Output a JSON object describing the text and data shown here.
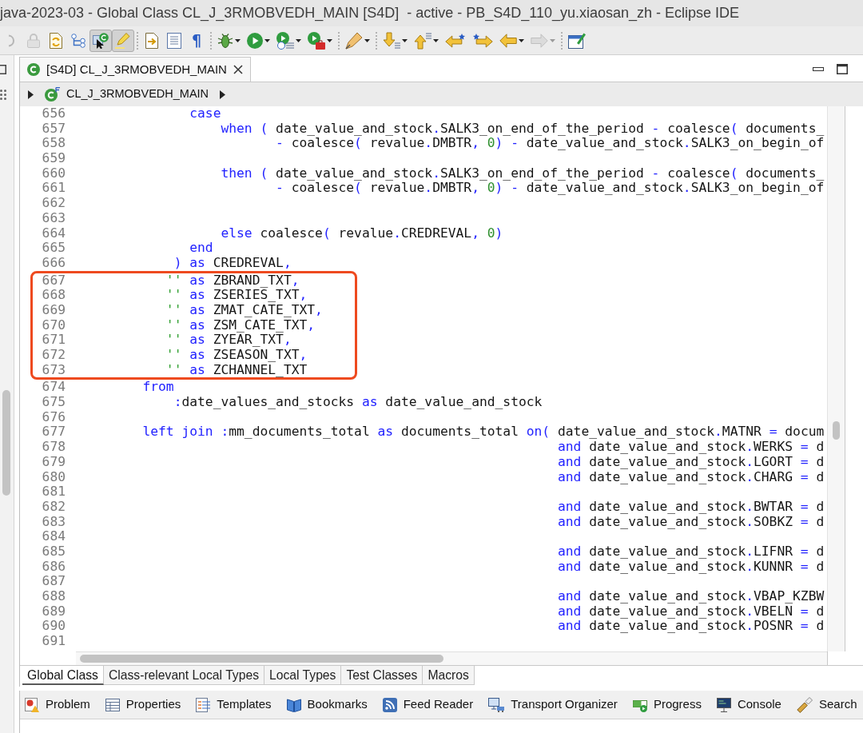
{
  "window": {
    "title": "java-2023-03 - Global Class CL_J_3RMOBVEDH_MAIN [S4D]  - active - PB_S4D_110_yu.xiaosan_zh - Eclipse IDE"
  },
  "toolbar": [
    {
      "kind": "button",
      "on": false,
      "disabled": true,
      "dropdown": false
    },
    {
      "kind": "button",
      "on": false,
      "disabled": true,
      "dropdown": false
    },
    {
      "kind": "button",
      "on": false,
      "disabled": false,
      "dropdown": false
    },
    {
      "kind": "button",
      "on": false,
      "disabled": false,
      "dropdown": false
    },
    {
      "kind": "button",
      "on": true,
      "disabled": false,
      "dropdown": false
    },
    {
      "kind": "button",
      "on": true,
      "disabled": false,
      "dropdown": false
    },
    {
      "kind": "separator"
    },
    {
      "kind": "button",
      "on": false,
      "disabled": false,
      "dropdown": false
    },
    {
      "kind": "button",
      "on": false,
      "disabled": false,
      "dropdown": false
    },
    {
      "kind": "glyph",
      "label": "¶",
      "on": false,
      "disabled": false,
      "dropdown": false
    },
    {
      "kind": "separator"
    },
    {
      "kind": "button",
      "on": false,
      "disabled": false,
      "dropdown": true
    },
    {
      "kind": "button",
      "on": false,
      "disabled": false,
      "dropdown": true
    },
    {
      "kind": "button",
      "on": false,
      "disabled": false,
      "dropdown": true
    },
    {
      "kind": "button",
      "on": false,
      "disabled": false,
      "dropdown": true
    },
    {
      "kind": "separator"
    },
    {
      "kind": "button",
      "on": false,
      "disabled": false,
      "dropdown": true
    },
    {
      "kind": "separator"
    },
    {
      "kind": "button",
      "on": false,
      "disabled": false,
      "dropdown": true
    },
    {
      "kind": "button",
      "on": false,
      "disabled": false,
      "dropdown": true
    },
    {
      "kind": "button",
      "on": false,
      "disabled": false,
      "dropdown": false
    },
    {
      "kind": "button",
      "on": false,
      "disabled": false,
      "dropdown": false
    },
    {
      "kind": "button",
      "on": false,
      "disabled": false,
      "dropdown": true
    },
    {
      "kind": "button",
      "on": false,
      "disabled": true,
      "dropdown": true
    },
    {
      "kind": "separator"
    },
    {
      "kind": "button",
      "on": false,
      "disabled": false,
      "dropdown": false
    }
  ],
  "editor": {
    "tabs": [
      {
        "label": "[S4D] CL_J_3RMOBVEDH_MAIN",
        "selected": true
      }
    ],
    "breadcrumb": {
      "label": "CL_J_3RMOBVEDH_MAIN"
    },
    "blocks": [
      {
        "highlighted": false,
        "lines": [
          {
            "number": "656",
            "code": [
              {
                "kind": "keyword",
                "text": "              case"
              }
            ]
          },
          {
            "number": "657",
            "code": [
              {
                "kind": "keyword",
                "text": "                  when ( "
              },
              {
                "kind": "plain",
                "text": "date_value_and_stock"
              },
              {
                "kind": "keyword",
                "text": "."
              },
              {
                "kind": "plain",
                "text": "SALK3_on_end_of_the_period "
              },
              {
                "kind": "keyword",
                "text": "- "
              },
              {
                "kind": "plain",
                "text": "coalesce"
              },
              {
                "kind": "keyword",
                "text": "( "
              },
              {
                "kind": "plain",
                "text": "documents_"
              }
            ]
          },
          {
            "number": "658",
            "code": [
              {
                "kind": "keyword",
                "text": "                         - "
              },
              {
                "kind": "plain",
                "text": "coalesce"
              },
              {
                "kind": "keyword",
                "text": "( "
              },
              {
                "kind": "plain",
                "text": "revalue"
              },
              {
                "kind": "keyword",
                "text": "."
              },
              {
                "kind": "plain",
                "text": "DMBTR"
              },
              {
                "kind": "keyword",
                "text": ", "
              },
              {
                "kind": "number",
                "text": "0"
              },
              {
                "kind": "keyword",
                "text": ") - "
              },
              {
                "kind": "plain",
                "text": "date_value_and_stock"
              },
              {
                "kind": "keyword",
                "text": "."
              },
              {
                "kind": "plain",
                "text": "SALK3_on_begin_of"
              }
            ]
          },
          {
            "number": "659"
          },
          {
            "number": "660",
            "code": [
              {
                "kind": "keyword",
                "text": "                  then ( "
              },
              {
                "kind": "plain",
                "text": "date_value_and_stock"
              },
              {
                "kind": "keyword",
                "text": "."
              },
              {
                "kind": "plain",
                "text": "SALK3_on_end_of_the_period "
              },
              {
                "kind": "keyword",
                "text": "- "
              },
              {
                "kind": "plain",
                "text": "coalesce"
              },
              {
                "kind": "keyword",
                "text": "( "
              },
              {
                "kind": "plain",
                "text": "documents_"
              }
            ]
          },
          {
            "number": "661",
            "code": [
              {
                "kind": "keyword",
                "text": "                         - "
              },
              {
                "kind": "plain",
                "text": "coalesce"
              },
              {
                "kind": "keyword",
                "text": "( "
              },
              {
                "kind": "plain",
                "text": "revalue"
              },
              {
                "kind": "keyword",
                "text": "."
              },
              {
                "kind": "plain",
                "text": "DMBTR"
              },
              {
                "kind": "keyword",
                "text": ", "
              },
              {
                "kind": "number",
                "text": "0"
              },
              {
                "kind": "keyword",
                "text": ") - "
              },
              {
                "kind": "plain",
                "text": "date_value_and_stock"
              },
              {
                "kind": "keyword",
                "text": "."
              },
              {
                "kind": "plain",
                "text": "SALK3_on_begin_of"
              }
            ]
          },
          {
            "number": "662"
          },
          {
            "number": "663"
          },
          {
            "number": "664",
            "code": [
              {
                "kind": "keyword",
                "text": "                  else "
              },
              {
                "kind": "plain",
                "text": "coalesce"
              },
              {
                "kind": "keyword",
                "text": "( "
              },
              {
                "kind": "plain",
                "text": "revalue"
              },
              {
                "kind": "keyword",
                "text": "."
              },
              {
                "kind": "plain",
                "text": "CREDREVAL"
              },
              {
                "kind": "keyword",
                "text": ", "
              },
              {
                "kind": "number",
                "text": "0"
              },
              {
                "kind": "keyword",
                "text": ")"
              }
            ]
          },
          {
            "number": "665",
            "code": [
              {
                "kind": "keyword",
                "text": "              end"
              }
            ]
          },
          {
            "number": "666",
            "code": [
              {
                "kind": "keyword",
                "text": "            ) as "
              },
              {
                "kind": "plain",
                "text": "CREDREVAL"
              },
              {
                "kind": "keyword",
                "text": ","
              }
            ]
          }
        ]
      },
      {
        "highlighted": true,
        "lines": [
          {
            "number": "667",
            "code": [
              {
                "kind": "string",
                "text": "           ''"
              },
              {
                "kind": "keyword",
                "text": " as "
              },
              {
                "kind": "plain",
                "text": "ZBRAND_TXT"
              },
              {
                "kind": "keyword",
                "text": ","
              }
            ]
          },
          {
            "number": "668",
            "code": [
              {
                "kind": "string",
                "text": "           ''"
              },
              {
                "kind": "keyword",
                "text": " as "
              },
              {
                "kind": "plain",
                "text": "ZSERIES_TXT"
              },
              {
                "kind": "keyword",
                "text": ","
              }
            ]
          },
          {
            "number": "669",
            "code": [
              {
                "kind": "string",
                "text": "           ''"
              },
              {
                "kind": "keyword",
                "text": " as "
              },
              {
                "kind": "plain",
                "text": "ZMAT_CATE_TXT"
              },
              {
                "kind": "keyword",
                "text": ","
              }
            ]
          },
          {
            "number": "670",
            "code": [
              {
                "kind": "string",
                "text": "           ''"
              },
              {
                "kind": "keyword",
                "text": " as "
              },
              {
                "kind": "plain",
                "text": "ZSM_CATE_TXT"
              },
              {
                "kind": "keyword",
                "text": ","
              }
            ]
          },
          {
            "number": "671",
            "code": [
              {
                "kind": "string",
                "text": "           ''"
              },
              {
                "kind": "keyword",
                "text": " as "
              },
              {
                "kind": "plain",
                "text": "ZYEAR_TXT"
              },
              {
                "kind": "keyword",
                "text": ","
              }
            ]
          },
          {
            "number": "672",
            "code": [
              {
                "kind": "string",
                "text": "           ''"
              },
              {
                "kind": "keyword",
                "text": " as "
              },
              {
                "kind": "plain",
                "text": "ZSEASON_TXT"
              },
              {
                "kind": "keyword",
                "text": ","
              }
            ]
          },
          {
            "number": "673",
            "code": [
              {
                "kind": "string",
                "text": "           ''"
              },
              {
                "kind": "keyword",
                "text": " as "
              },
              {
                "kind": "plain",
                "text": "ZCHANNEL_TXT"
              }
            ]
          }
        ]
      },
      {
        "highlighted": false,
        "lines": [
          {
            "number": "674",
            "code": [
              {
                "kind": "keyword",
                "text": "        from"
              }
            ]
          },
          {
            "number": "675",
            "code": [
              {
                "kind": "keyword",
                "text": "            :"
              },
              {
                "kind": "plain",
                "text": "date_values_and_stocks "
              },
              {
                "kind": "keyword",
                "text": "as "
              },
              {
                "kind": "plain",
                "text": "date_value_and_stock"
              }
            ]
          },
          {
            "number": "676"
          },
          {
            "number": "677",
            "code": [
              {
                "kind": "keyword",
                "text": "        left join :"
              },
              {
                "kind": "plain",
                "text": "mm_documents_total "
              },
              {
                "kind": "keyword",
                "text": "as "
              },
              {
                "kind": "plain",
                "text": "documents_total "
              },
              {
                "kind": "keyword",
                "text": "on( "
              },
              {
                "kind": "plain",
                "text": "date_value_and_stock"
              },
              {
                "kind": "keyword",
                "text": "."
              },
              {
                "kind": "plain",
                "text": "MATNR "
              },
              {
                "kind": "keyword",
                "text": "= "
              },
              {
                "kind": "plain",
                "text": "docum"
              }
            ]
          },
          {
            "number": "678",
            "code": [
              {
                "kind": "keyword",
                "text": "                                                             and "
              },
              {
                "kind": "plain",
                "text": "date_value_and_stock"
              },
              {
                "kind": "keyword",
                "text": "."
              },
              {
                "kind": "plain",
                "text": "WERKS "
              },
              {
                "kind": "keyword",
                "text": "= "
              },
              {
                "kind": "plain",
                "text": "d"
              }
            ]
          },
          {
            "number": "679",
            "code": [
              {
                "kind": "keyword",
                "text": "                                                             and "
              },
              {
                "kind": "plain",
                "text": "date_value_and_stock"
              },
              {
                "kind": "keyword",
                "text": "."
              },
              {
                "kind": "plain",
                "text": "LGORT "
              },
              {
                "kind": "keyword",
                "text": "= "
              },
              {
                "kind": "plain",
                "text": "d"
              }
            ]
          },
          {
            "number": "680",
            "code": [
              {
                "kind": "keyword",
                "text": "                                                             and "
              },
              {
                "kind": "plain",
                "text": "date_value_and_stock"
              },
              {
                "kind": "keyword",
                "text": "."
              },
              {
                "kind": "plain",
                "text": "CHARG "
              },
              {
                "kind": "keyword",
                "text": "= "
              },
              {
                "kind": "plain",
                "text": "d"
              }
            ]
          },
          {
            "number": "681"
          },
          {
            "number": "682",
            "code": [
              {
                "kind": "keyword",
                "text": "                                                             and "
              },
              {
                "kind": "plain",
                "text": "date_value_and_stock"
              },
              {
                "kind": "keyword",
                "text": "."
              },
              {
                "kind": "plain",
                "text": "BWTAR "
              },
              {
                "kind": "keyword",
                "text": "= "
              },
              {
                "kind": "plain",
                "text": "d"
              }
            ]
          },
          {
            "number": "683",
            "code": [
              {
                "kind": "keyword",
                "text": "                                                             and "
              },
              {
                "kind": "plain",
                "text": "date_value_and_stock"
              },
              {
                "kind": "keyword",
                "text": "."
              },
              {
                "kind": "plain",
                "text": "SOBKZ "
              },
              {
                "kind": "keyword",
                "text": "= "
              },
              {
                "kind": "plain",
                "text": "d"
              }
            ]
          },
          {
            "number": "684"
          },
          {
            "number": "685",
            "code": [
              {
                "kind": "keyword",
                "text": "                                                             and "
              },
              {
                "kind": "plain",
                "text": "date_value_and_stock"
              },
              {
                "kind": "keyword",
                "text": "."
              },
              {
                "kind": "plain",
                "text": "LIFNR "
              },
              {
                "kind": "keyword",
                "text": "= "
              },
              {
                "kind": "plain",
                "text": "d"
              }
            ]
          },
          {
            "number": "686",
            "code": [
              {
                "kind": "keyword",
                "text": "                                                             and "
              },
              {
                "kind": "plain",
                "text": "date_value_and_stock"
              },
              {
                "kind": "keyword",
                "text": "."
              },
              {
                "kind": "plain",
                "text": "KUNNR "
              },
              {
                "kind": "keyword",
                "text": "= "
              },
              {
                "kind": "plain",
                "text": "d"
              }
            ]
          },
          {
            "number": "687"
          },
          {
            "number": "688",
            "code": [
              {
                "kind": "keyword",
                "text": "                                                             and "
              },
              {
                "kind": "plain",
                "text": "date_value_and_stock"
              },
              {
                "kind": "keyword",
                "text": "."
              },
              {
                "kind": "plain",
                "text": "VBAP_KZBW"
              }
            ]
          },
          {
            "number": "689",
            "code": [
              {
                "kind": "keyword",
                "text": "                                                             and "
              },
              {
                "kind": "plain",
                "text": "date_value_and_stock"
              },
              {
                "kind": "keyword",
                "text": "."
              },
              {
                "kind": "plain",
                "text": "VBELN "
              },
              {
                "kind": "keyword",
                "text": "= "
              },
              {
                "kind": "plain",
                "text": "d"
              }
            ]
          },
          {
            "number": "690",
            "code": [
              {
                "kind": "keyword",
                "text": "                                                             and "
              },
              {
                "kind": "plain",
                "text": "date_value_and_stock"
              },
              {
                "kind": "keyword",
                "text": "."
              },
              {
                "kind": "plain",
                "text": "POSNR "
              },
              {
                "kind": "keyword",
                "text": "= "
              },
              {
                "kind": "plain",
                "text": "d"
              }
            ]
          },
          {
            "number": "691"
          }
        ]
      }
    ],
    "page_tabs": [
      {
        "label": "Global Class",
        "selected": true
      },
      {
        "label": "Class-relevant Local Types",
        "selected": false
      },
      {
        "label": "Local Types",
        "selected": false
      },
      {
        "label": "Test Classes",
        "selected": false
      },
      {
        "label": "Macros",
        "selected": false
      }
    ]
  },
  "views": {
    "tabs": [
      {
        "label": "Problem"
      },
      {
        "label": "Properties"
      },
      {
        "label": "Templates"
      },
      {
        "label": "Bookmarks"
      },
      {
        "label": "Feed Reader"
      },
      {
        "label": "Transport Organizer"
      },
      {
        "label": "Progress"
      },
      {
        "label": "Console"
      },
      {
        "label": "Search"
      }
    ]
  }
}
